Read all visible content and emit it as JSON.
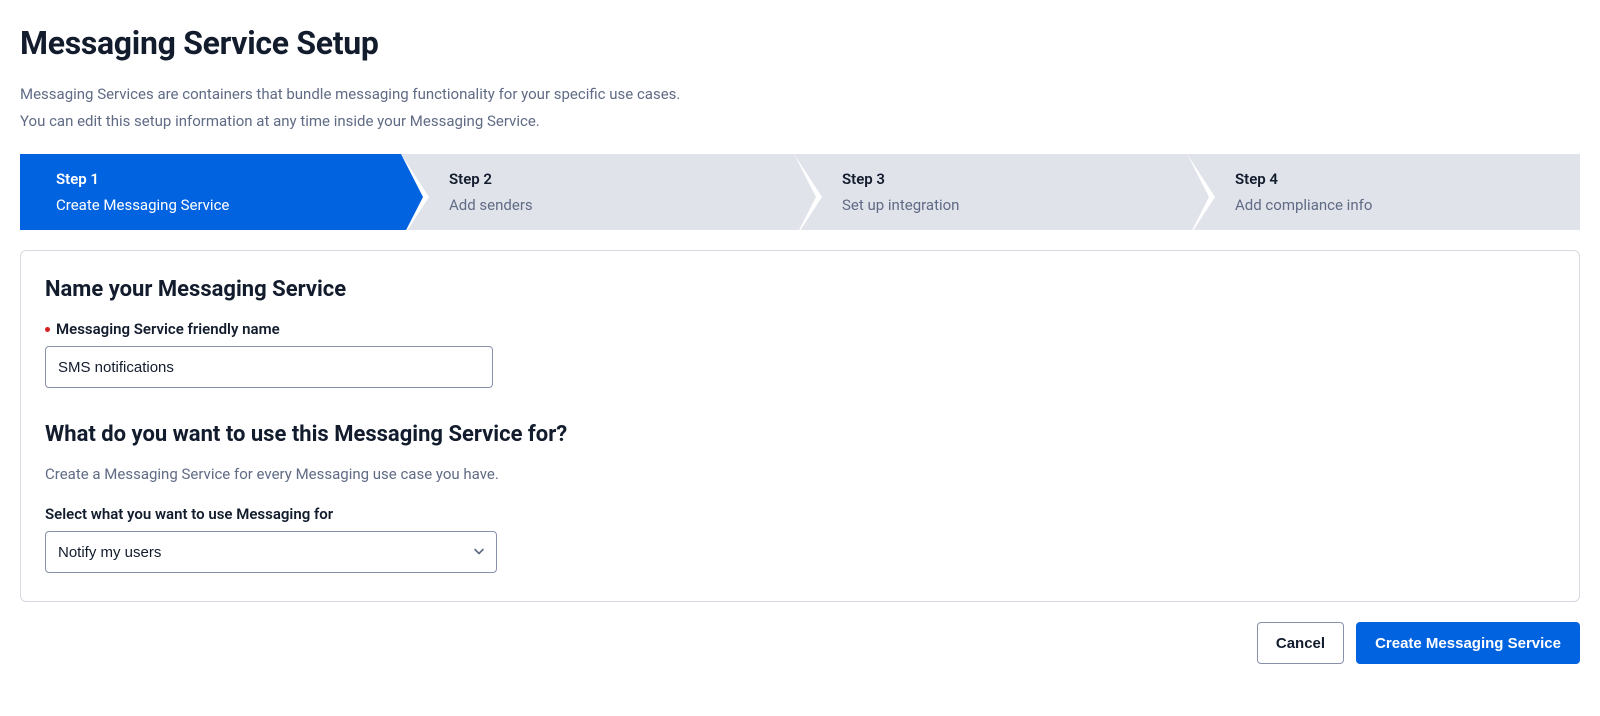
{
  "page": {
    "title": "Messaging Service Setup",
    "intro_line1": "Messaging Services are containers that bundle messaging functionality for your specific use cases.",
    "intro_line2": "You can edit this setup information at any time inside your Messaging Service."
  },
  "stepper": {
    "steps": [
      {
        "label": "Step 1",
        "desc": "Create Messaging Service",
        "active": true
      },
      {
        "label": "Step 2",
        "desc": "Add senders",
        "active": false
      },
      {
        "label": "Step 3",
        "desc": "Set up integration",
        "active": false
      },
      {
        "label": "Step 4",
        "desc": "Add compliance info",
        "active": false
      }
    ]
  },
  "form": {
    "name_section_title": "Name your Messaging Service",
    "name_label": "Messaging Service friendly name",
    "name_value": "SMS notifications",
    "use_section_title": "What do you want to use this Messaging Service for?",
    "use_helper": "Create a Messaging Service for every Messaging use case you have.",
    "use_label": "Select what you want to use Messaging for",
    "use_value": "Notify my users"
  },
  "footer": {
    "cancel_label": "Cancel",
    "submit_label": "Create Messaging Service"
  }
}
